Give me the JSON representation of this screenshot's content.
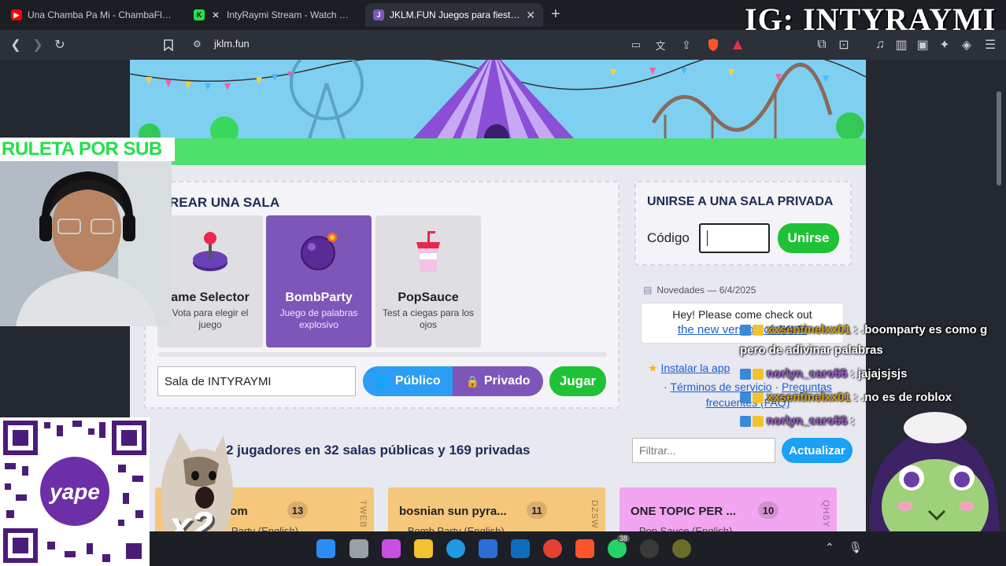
{
  "tabs": [
    {
      "label": "Una Chamba Pa Mi - ChambaFlow (P...",
      "favicon": "youtube-icon",
      "color": "#ff0000"
    },
    {
      "label": "IntyRaymi Stream - Watch Live on...",
      "favicon": "kick-icon",
      "color": "#22e04a"
    },
    {
      "label": "JKLM.FUN Juegos para fiestas en...",
      "favicon": "jklm-icon",
      "color": "#7e55b8",
      "active": true
    }
  ],
  "watermark": "IG: INTYRAYMI",
  "address_bar": {
    "url": "jklm.fun"
  },
  "create_room": {
    "title": "REAR UNA SALA",
    "games": [
      {
        "name": "ame Selector",
        "desc": "Vota para elegir el juego",
        "icon": "joystick-icon"
      },
      {
        "name": "BombParty",
        "desc": "Juego de palabras explosivo",
        "icon": "bomb-icon",
        "selected": true
      },
      {
        "name": "PopSauce",
        "desc": "Test a ciegas para los ojos",
        "icon": "drink-cup-icon"
      }
    ],
    "room_name": "Sala de INTYRAYMI",
    "public_label": "Público",
    "private_label": "Privado",
    "play_label": "Jugar"
  },
  "join_room": {
    "title": "UNIRSE A UNA SALA PRIVADA",
    "code_label": "Código",
    "code_value": "",
    "join_label": "Unirse"
  },
  "news": {
    "header": "Novedades — 6/4/2025",
    "text": "Hey! Please come check out",
    "link": "the new version of JKLM"
  },
  "links": {
    "install": "Instalar la app",
    "terms": "Términos de servicio",
    "sep": " · ",
    "faq": "Preguntas frecuentes (FAQ)"
  },
  "rooms": {
    "summary": "2 jugadores en 32 salas públicas y 169 privadas",
    "filter_placeholder": "Filtrar...",
    "refresh_label": "Actualizar",
    "items": [
      {
        "name": "oom",
        "count": "13",
        "sub": "...Party (English)",
        "code": "TWEB",
        "color": "#f5c77a"
      },
      {
        "name": "bosnian sun pyra...",
        "count": "11",
        "sub": "...Bomb Party (English)",
        "code": "DZSW",
        "color": "#f5c77a"
      },
      {
        "name": "ONE TOPIC PER ...",
        "count": "10",
        "sub": "...Pop Sauce (English)",
        "code": "QHSY",
        "color": "#f2a5f0"
      }
    ]
  },
  "overlays": {
    "ruleta": "RULETA POR SUB",
    "multiplier": "x2",
    "qr_brand": "yape",
    "chat": [
      {
        "user": "xxsentinelxx01",
        "msg": ": .boomparty es como g",
        "user_color": "#d4a017"
      },
      {
        "user": "",
        "msg": "pero de adivinar palabras",
        "user_color": "#ffffff"
      },
      {
        "user": "norlyn_caro55",
        "msg": ": jajajsjsjs",
        "user_color": "#9b59d0"
      },
      {
        "user": "xxsentinelxx01",
        "msg": ": .no es de roblox",
        "user_color": "#d4a017"
      },
      {
        "user": "norlyn_caro55",
        "msg": ":",
        "user_color": "#9b59d0"
      }
    ]
  },
  "taskbar": {
    "whatsapp_badge": "38"
  }
}
